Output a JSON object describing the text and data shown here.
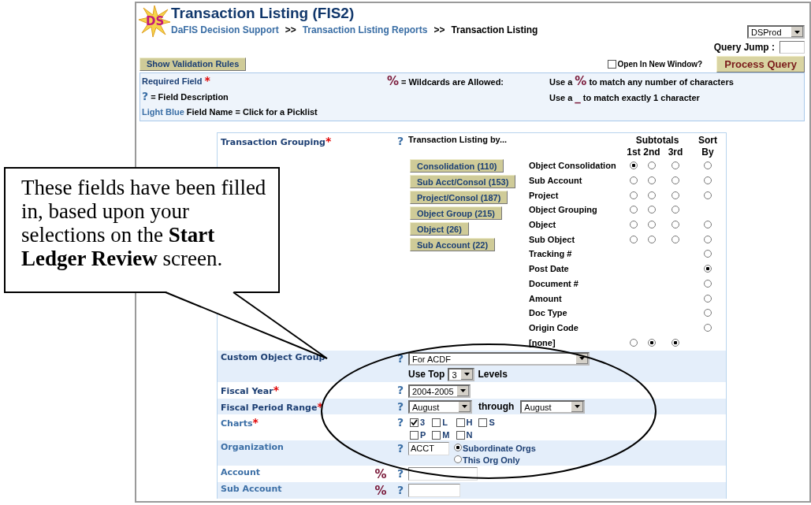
{
  "header": {
    "logo_text": "DS",
    "title": "Transaction Listing (FIS2)",
    "breadcrumb": [
      {
        "kind": "link",
        "label": "DaFIS Decision Support"
      },
      {
        "kind": "separator",
        "label": ">>"
      },
      {
        "kind": "link",
        "label": "Transaction Listing Reports"
      },
      {
        "kind": "separator",
        "label": ">>"
      },
      {
        "kind": "current",
        "label": "Transaction Listing"
      }
    ],
    "environment": {
      "value": "DSProd"
    },
    "query_jump": {
      "label": "Query Jump :"
    }
  },
  "toolbar": {
    "validation_button": "Show Validation Rules",
    "new_window": {
      "label": "Open In New Window?",
      "checked": false
    },
    "process_button": "Process Query"
  },
  "legend": {
    "required": {
      "label": "Required Field",
      "mark": "*"
    },
    "help": {
      "mark": "?",
      "text": "= Field Description"
    },
    "picklist": {
      "sample": "Light Blue",
      "text": "Field Name = Click for a Picklist"
    },
    "wildcard": {
      "mark": "%",
      "text": "= Wildcards are Allowed:"
    },
    "usage": [
      {
        "before": "Use a",
        "mark": "%",
        "after": "to match any number of characters"
      },
      {
        "before": "Use a",
        "mark": "_",
        "after": "to match exactly 1 character"
      }
    ]
  },
  "form": {
    "rows": [
      {
        "kind": "grouping",
        "label": "Transaction Grouping",
        "picklist": false,
        "required_mark": "*",
        "help": "?",
        "heading": "Transaction Listing by...",
        "buttons": [
          "Consolidation (110)",
          "Sub Acct/Consol (153)",
          "Project/Consol (187)",
          "Object Group (215)",
          "Object (26)",
          "Sub Account (22)"
        ],
        "columns": {
          "subtotals": "Subtotals",
          "first": "1st",
          "second": "2nd",
          "third": "3rd",
          "sort": "Sort By"
        },
        "options": [
          {
            "label": "Object Consolidation",
            "subtotals": [
              {
                "selected": true
              },
              {
                "selected": false
              },
              {
                "selected": false
              }
            ],
            "sort": {
              "selected": false
            }
          },
          {
            "label": "Sub Account",
            "subtotals": [
              {
                "selected": false
              },
              {
                "selected": false
              },
              {
                "selected": false
              }
            ],
            "sort": {
              "selected": false
            }
          },
          {
            "label": "Project",
            "subtotals": [
              {
                "selected": false
              },
              {
                "selected": false
              },
              {
                "selected": false
              }
            ],
            "sort": {
              "selected": false
            }
          },
          {
            "label": "Object Grouping",
            "subtotals": [
              {
                "selected": false
              },
              {
                "selected": false
              },
              {
                "selected": false
              }
            ]
          },
          {
            "label": "Object",
            "subtotals": [
              {
                "selected": false
              },
              {
                "selected": false
              },
              {
                "selected": false
              }
            ],
            "sort": {
              "selected": false
            }
          },
          {
            "label": "Sub Object",
            "subtotals": [
              {
                "selected": false
              },
              {
                "selected": false
              },
              {
                "selected": false
              }
            ],
            "sort": {
              "selected": false
            }
          },
          {
            "label": "Tracking #",
            "sort": {
              "selected": false
            }
          },
          {
            "label": "Post Date",
            "sort": {
              "selected": true
            }
          },
          {
            "label": "Document #",
            "sort": {
              "selected": false
            }
          },
          {
            "label": "Amount",
            "sort": {
              "selected": false
            }
          },
          {
            "label": "Doc Type",
            "sort": {
              "selected": false
            }
          },
          {
            "label": "Origin Code",
            "sort": {
              "selected": false
            }
          },
          {
            "label": "[none]",
            "subtotals": [
              {
                "selected": false
              },
              {
                "selected": true
              },
              {
                "selected": true
              }
            ]
          }
        ]
      },
      {
        "kind": "custom_group",
        "label": "Custom Object Group",
        "picklist": false,
        "help": "?",
        "value": "For ACDF",
        "levels_before": "Use Top",
        "levels_value": "3",
        "levels_after": "Levels"
      },
      {
        "kind": "select",
        "label": "Fiscal Year",
        "picklist": false,
        "required_mark": "*",
        "help": "?",
        "value": "2004-2005"
      },
      {
        "kind": "range",
        "label": "Fiscal Period Range",
        "picklist": false,
        "required_mark": "*",
        "help": "?",
        "from": "August",
        "joiner": "through",
        "to": "August"
      },
      {
        "kind": "checkboxes",
        "label": "Charts",
        "picklist": true,
        "required_mark": "*",
        "help": "?",
        "options": [
          {
            "label": "3",
            "checked": true
          },
          {
            "label": "L",
            "checked": false
          },
          {
            "label": "H",
            "checked": false
          },
          {
            "label": "S",
            "checked": false
          },
          {
            "label": "P",
            "checked": false
          },
          {
            "label": "M",
            "checked": false
          },
          {
            "label": "N",
            "checked": false
          }
        ]
      },
      {
        "kind": "organization",
        "label": "Organization",
        "picklist": true,
        "help": "?",
        "value": "ACCT",
        "scopes": [
          {
            "label": "Subordinate Orgs",
            "selected": true
          },
          {
            "label": "This Org Only",
            "selected": false
          }
        ]
      },
      {
        "kind": "text",
        "label": "Account",
        "picklist": true,
        "wildcard": "%",
        "help": "?"
      },
      {
        "kind": "text",
        "label": "Sub Account",
        "picklist": true,
        "wildcard": "%",
        "help": "?"
      }
    ]
  },
  "callout": {
    "text": "These fields have been filled in, based upon your selections on the **Start Ledger Review** screen."
  }
}
